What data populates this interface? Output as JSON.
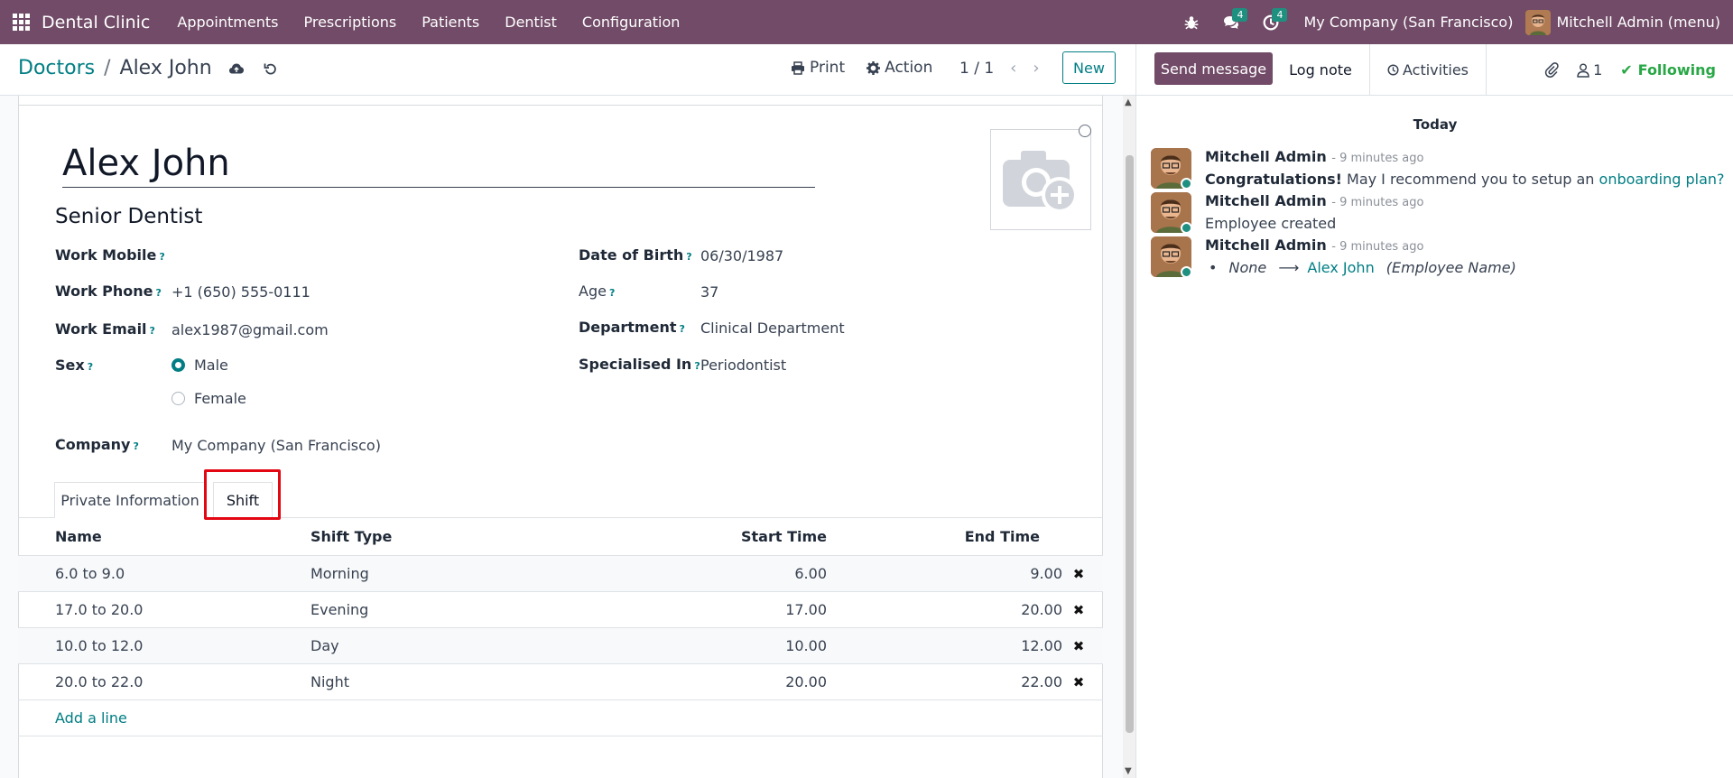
{
  "topbar": {
    "brand": "Dental Clinic",
    "menu": [
      "Appointments",
      "Prescriptions",
      "Patients",
      "Dentist",
      "Configuration"
    ],
    "messages_count": "4",
    "activities_count": "4",
    "company": "My Company (San Francisco)",
    "user": "Mitchell Admin (menu)"
  },
  "control": {
    "breadcrumb_parent": "Doctors",
    "breadcrumb_sep": "/",
    "breadcrumb_current": "Alex John",
    "print_label": "Print",
    "action_label": "Action",
    "pager": "1 / 1",
    "new_label": "New"
  },
  "form": {
    "name": "Alex John",
    "job_title": "Senior Dentist",
    "q": "?",
    "work_mobile_label": "Work Mobile",
    "work_mobile": "",
    "work_phone_label": "Work Phone",
    "work_phone": "+1 (650) 555-0111",
    "work_email_label": "Work Email",
    "work_email": "alex1987@gmail.com",
    "sex_label": "Sex",
    "sex_options": [
      "Male",
      "Female"
    ],
    "sex_selected": "Male",
    "company_label": "Company",
    "company": "My Company (San Francisco)",
    "dob_label": "Date of Birth",
    "dob": "06/30/1987",
    "age_label": "Age",
    "age": "37",
    "department_label": "Department",
    "department": "Clinical Department",
    "specialised_label": "Specialised In",
    "specialised": "Periodontist"
  },
  "tabs": [
    {
      "label": "Private Information",
      "active": false
    },
    {
      "label": "Shift",
      "active": true
    }
  ],
  "shift_table": {
    "headers": [
      "Name",
      "Shift Type",
      "Start Time",
      "End Time"
    ],
    "rows": [
      {
        "name": "6.0 to 9.0",
        "type": "Morning",
        "start": "6.00",
        "end": "9.00"
      },
      {
        "name": "17.0 to 20.0",
        "type": "Evening",
        "start": "17.00",
        "end": "20.00"
      },
      {
        "name": "10.0 to 12.0",
        "type": "Day",
        "start": "10.00",
        "end": "12.00"
      },
      {
        "name": "20.0 to 22.0",
        "type": "Night",
        "start": "20.00",
        "end": "22.00"
      }
    ],
    "delete_glyph": "✖",
    "add_line": "Add a line"
  },
  "chatter": {
    "send_message": "Send message",
    "log_note": "Log note",
    "activities": "Activities",
    "followers": "1",
    "following": "Following",
    "today": "Today",
    "messages": [
      {
        "author": "Mitchell Admin",
        "time": "- 9 minutes ago",
        "bold": "Congratulations!",
        "text": " May I recommend you to setup an ",
        "link": "onboarding plan?"
      },
      {
        "author": "Mitchell Admin",
        "time": "- 9 minutes ago",
        "text": "Employee created"
      },
      {
        "author": "Mitchell Admin",
        "time": "- 9 minutes ago",
        "old": "None",
        "arrow": "⟶",
        "new": "Alex John",
        "field": "(Employee Name)"
      }
    ]
  },
  "colors": {
    "brand": "#714B67",
    "accent": "#017e84",
    "highlight": "#e30613",
    "following": "#28a745"
  }
}
